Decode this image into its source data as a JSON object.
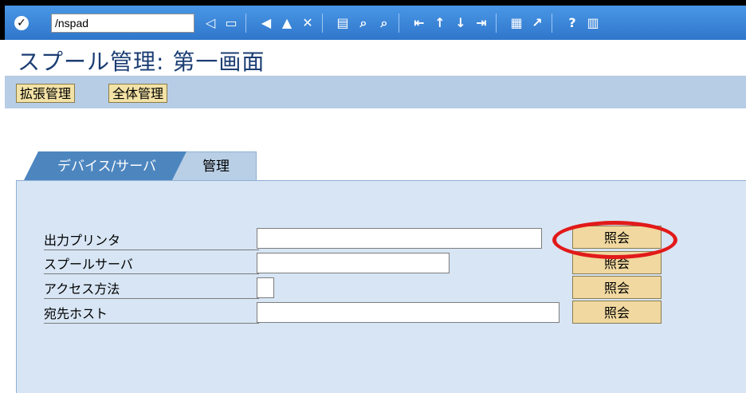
{
  "toolbar": {
    "command_value": "/nspad",
    "icons": [
      "enter-icon",
      "command-history-icon",
      "back-arrow-icon",
      "save-icon",
      "back-icon",
      "exit-icon",
      "cancel-icon",
      "print-icon",
      "find-icon",
      "find-next-icon",
      "first-page-icon",
      "previous-page-icon",
      "next-page-icon",
      "last-page-icon",
      "new-session-icon",
      "shortcut-icon",
      "help-icon",
      "customize-layout-icon"
    ]
  },
  "title": "スプール管理: 第一画面",
  "menu_buttons": [
    {
      "label": "拡張管理"
    },
    {
      "label": "全体管理"
    }
  ],
  "tabs": [
    {
      "label": "デバイス/サーバ",
      "selected": true
    },
    {
      "label": "管理",
      "selected": false
    }
  ],
  "fields": [
    {
      "label": "出力プリンタ",
      "value": "",
      "button": "照会"
    },
    {
      "label": "スプールサーバ",
      "value": "",
      "button": "照会"
    },
    {
      "label": "アクセス方法",
      "value": "",
      "button": "照会"
    },
    {
      "label": "宛先ホスト",
      "value": "",
      "button": "照会"
    }
  ],
  "colors": {
    "toolbar": "#2f7fd3",
    "panel": "#d7e5f4",
    "button": "#f0d8a0",
    "highlight": "#e21a1a"
  }
}
